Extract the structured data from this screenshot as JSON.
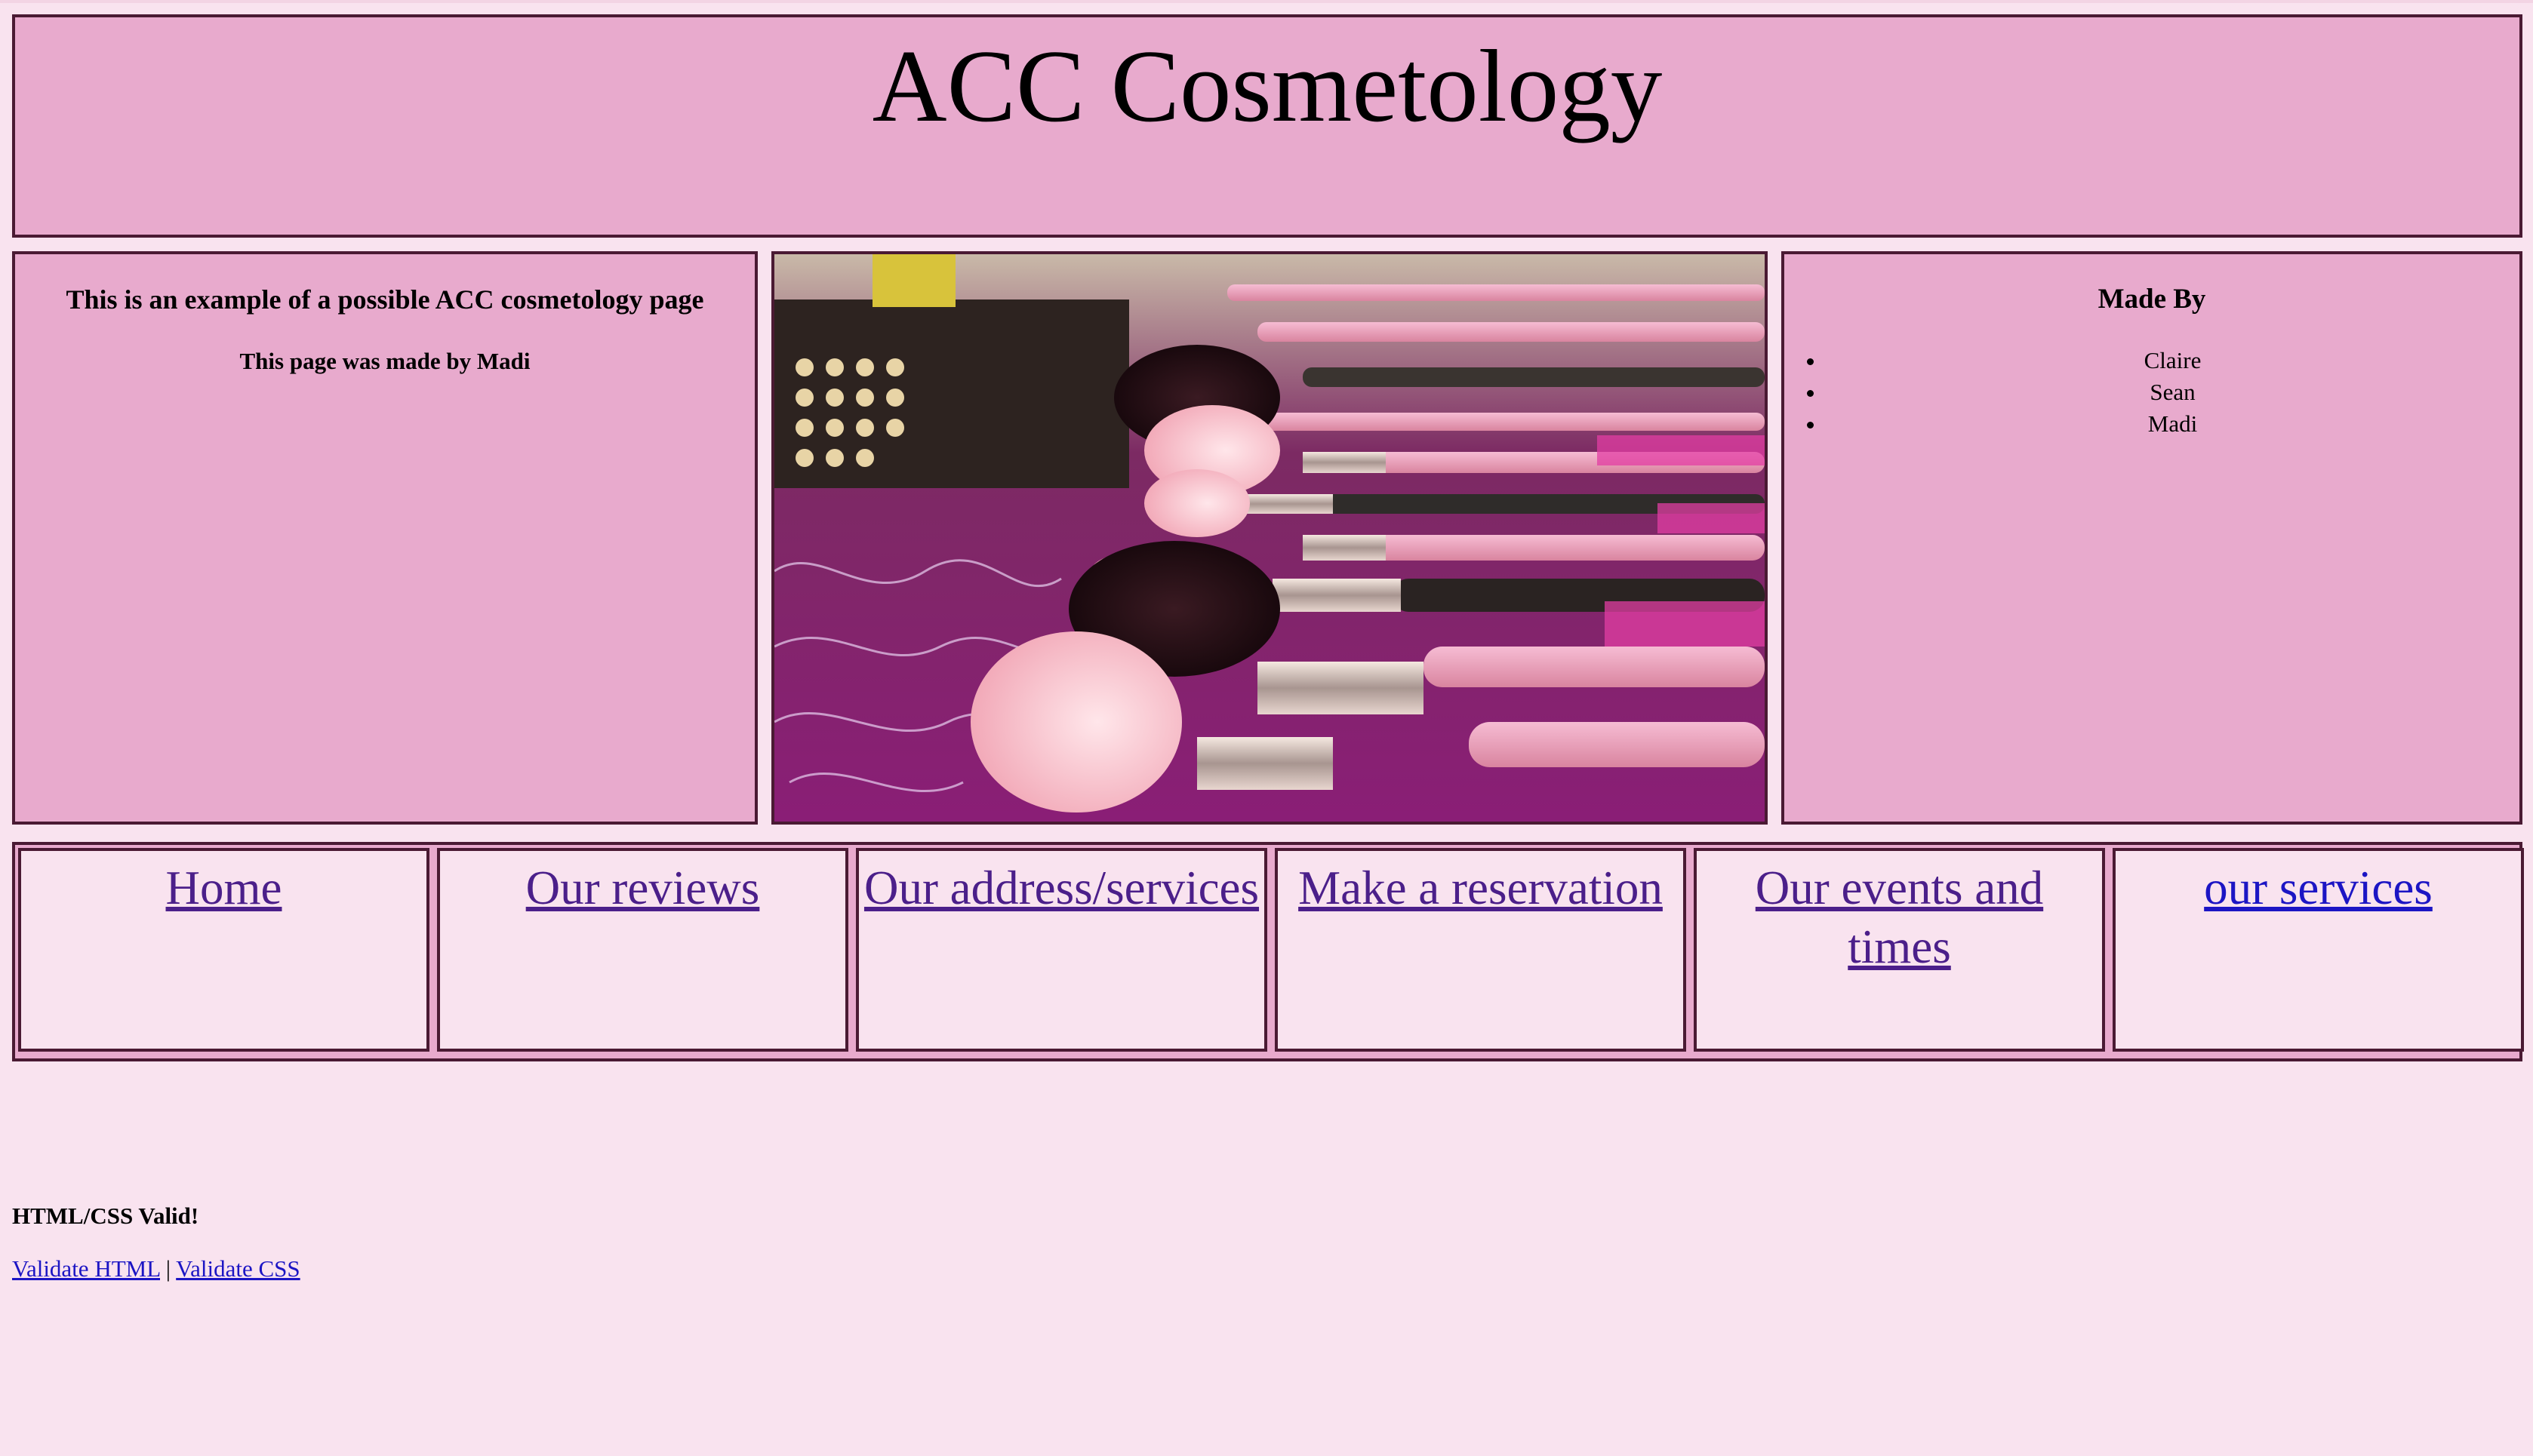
{
  "header": {
    "title": "ACC Cosmetology"
  },
  "left_panel": {
    "intro": "This is an example of a possible ACC cosmetology page",
    "credit": "This page was made by Madi"
  },
  "image": {
    "subject": "makeup-brushes-photo"
  },
  "right_panel": {
    "heading": "Made By",
    "members": [
      "Claire",
      "Sean",
      "Madi"
    ]
  },
  "nav": {
    "items": [
      {
        "label": "Home"
      },
      {
        "label": "Our reviews"
      },
      {
        "label": "Our address/services"
      },
      {
        "label": "Make a reservation"
      },
      {
        "label": "Our events and times"
      },
      {
        "label": "our services"
      }
    ]
  },
  "footer": {
    "title": "HTML/CSS Valid!",
    "validate_html": "Validate HTML",
    "separator": "|",
    "validate_css": "Validate CSS"
  },
  "colors": {
    "page_background": "#f9e3ef",
    "panel_background": "#e8aacd",
    "border": "#4a1a33",
    "visited_link": "#4b1f8a",
    "link": "#1c15c4"
  }
}
